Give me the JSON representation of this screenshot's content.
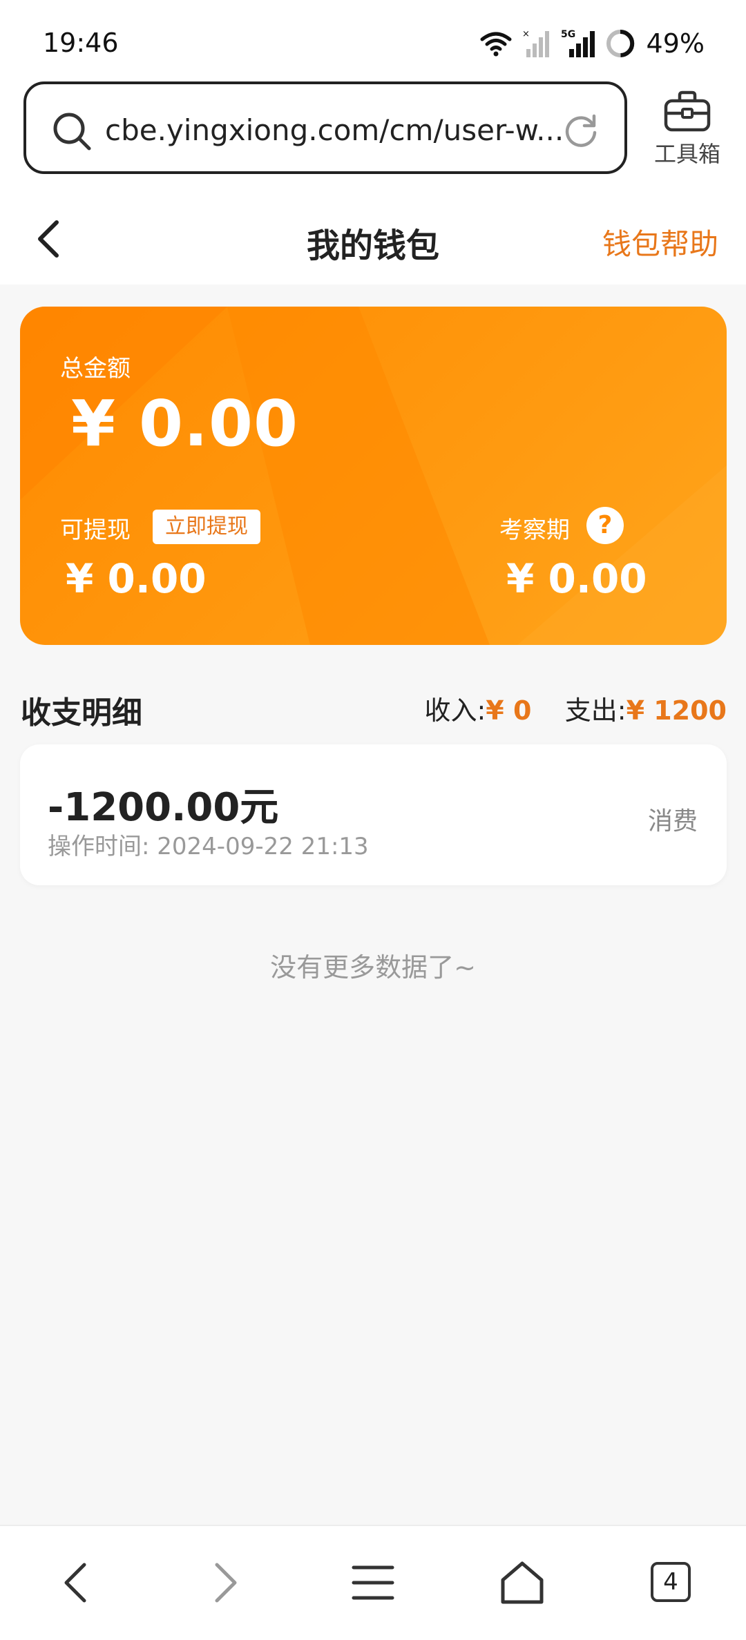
{
  "status_bar": {
    "time": "19:46",
    "network": "5G",
    "battery": "49%"
  },
  "browser": {
    "url": "cbe.yingxiong.com/cm/user-w...",
    "toolbox_label": "工具箱"
  },
  "header": {
    "title": "我的钱包",
    "help_label": "钱包帮助"
  },
  "wallet": {
    "total_label": "总金额",
    "total_value": "¥ 0.00",
    "withdrawable_label": "可提现",
    "withdraw_button": "立即提现",
    "withdrawable_value": "¥ 0.00",
    "review_label": "考察期",
    "review_help": "?",
    "review_value": "¥ 0.00",
    "colors": {
      "card_start": "#ff8a00",
      "card_end": "#ffa51c",
      "accent": "#e8771a"
    }
  },
  "details": {
    "title": "收支明细",
    "income_label": "收入:",
    "income_value": "¥ 0",
    "expense_label": "支出:",
    "expense_value": "¥ 1200"
  },
  "transactions": [
    {
      "amount": "-1200.00元",
      "time_label": "操作时间:",
      "time_value": "2024-09-22 21:13",
      "type": "消费"
    }
  ],
  "no_more_text": "没有更多数据了~",
  "bottom_nav": {
    "tab_count": "4"
  }
}
